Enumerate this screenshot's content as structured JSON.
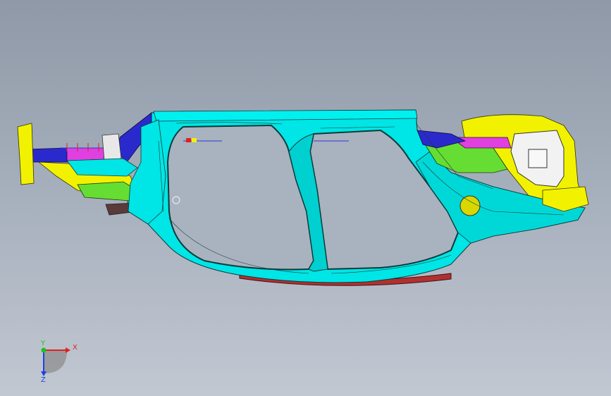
{
  "viewport": {
    "background_top": "#8f99a7",
    "background_bottom": "#c2c8d2"
  },
  "model": {
    "description_icon": "car-body-side-frame",
    "colors": {
      "body_side": "#00e5e5",
      "body_side_dark": "#00b8b8",
      "reinforcement_yellow": "#f2f200",
      "reinforcement_blue": "#2a2acc",
      "reinforcement_magenta": "#e040e0",
      "reinforcement_green": "#66dd33",
      "sill_red": "#b03030",
      "bracket_white": "#f2f2f2",
      "edge_lines": "#1a2a2a"
    }
  },
  "triad": {
    "x_label": "X",
    "y_label": "Y",
    "z_label": "Z",
    "x_color": "#e02020",
    "y_color": "#20c020",
    "z_color": "#2040e0"
  }
}
